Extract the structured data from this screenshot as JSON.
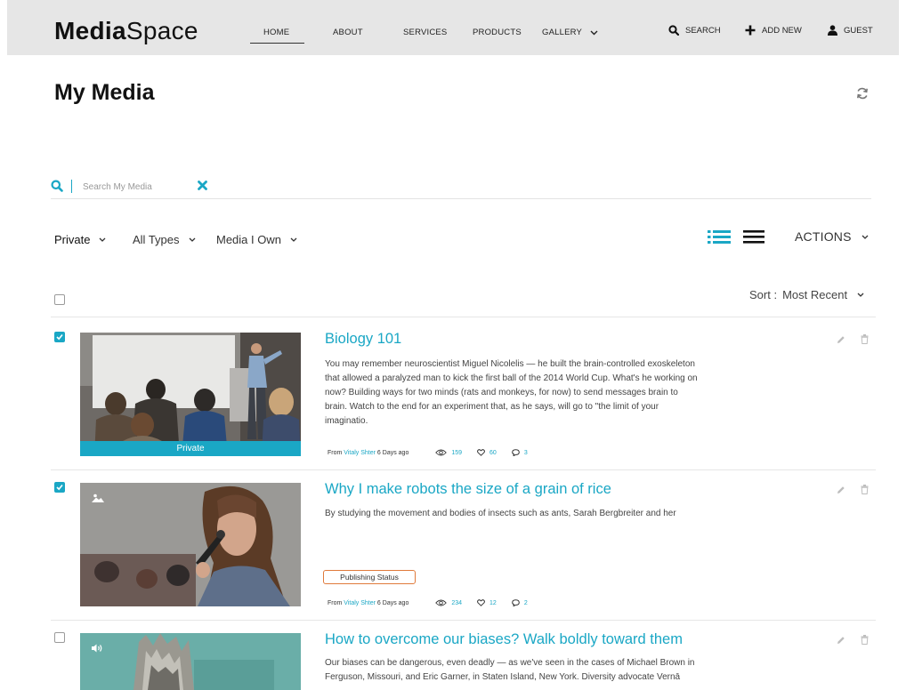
{
  "app": {
    "logo_bold": "Media",
    "logo_light": "Space"
  },
  "nav": {
    "items": [
      {
        "label": "HOME",
        "active": true
      },
      {
        "label": "ABOUT"
      },
      {
        "label": "SERVICES"
      },
      {
        "label": "PRODUCTS"
      },
      {
        "label": "GALLERY",
        "dropdown": true
      }
    ],
    "search_label": "SEARCH",
    "add_new_label": "ADD NEW",
    "user_label": "GUEST"
  },
  "page": {
    "title": "My Media"
  },
  "search": {
    "placeholder": "Search My Media",
    "value": ""
  },
  "filters": {
    "privacy": "Private",
    "types": "All Types",
    "ownership": "Media I Own"
  },
  "toolbar": {
    "actions_label": "ACTIONS",
    "sort_prefix": "Sort :",
    "sort_value": "Most Recent"
  },
  "colors": {
    "accent": "#1aa7c5",
    "status_border": "#e07a3b"
  },
  "media": [
    {
      "title": "Biology 101",
      "description": "You may remember neuroscientist Miguel Nicolelis — he built the brain-controlled exoskeleton that allowed a paralyzed man to kick the first ball of the 2014 World Cup. What's he working on now? Building ways for two minds (rats and monkeys, for now) to send messages brain to brain. Watch to the end for an experiment that, as he says, will go to \"the limit of your imaginatio.",
      "from_label": "From",
      "owner": "Vitaly Shter",
      "age": "6 Days ago",
      "views": "159",
      "likes": "60",
      "comments": "3",
      "checked": true,
      "badge": "Private",
      "type_icon": "video-icon"
    },
    {
      "title": "Why I make robots the size of a grain of rice",
      "description": "By studying the movement and bodies of insects such as ants, Sarah Bergbreiter and her",
      "from_label": "From",
      "owner": "Vitaly Shter",
      "age": "6 Days ago",
      "views": "234",
      "likes": "12",
      "comments": "2",
      "checked": true,
      "status_label": "Publishing Status",
      "type_icon": "image-icon"
    },
    {
      "title": "How to overcome our biases? Walk boldly toward them",
      "description": "Our biases can be dangerous, even deadly — as we've seen in the cases of Michael Brown in Ferguson, Missouri, and Eric Garner, in Staten Island, New York. Diversity advocate Vernā",
      "checked": false,
      "type_icon": "audio-icon"
    }
  ]
}
